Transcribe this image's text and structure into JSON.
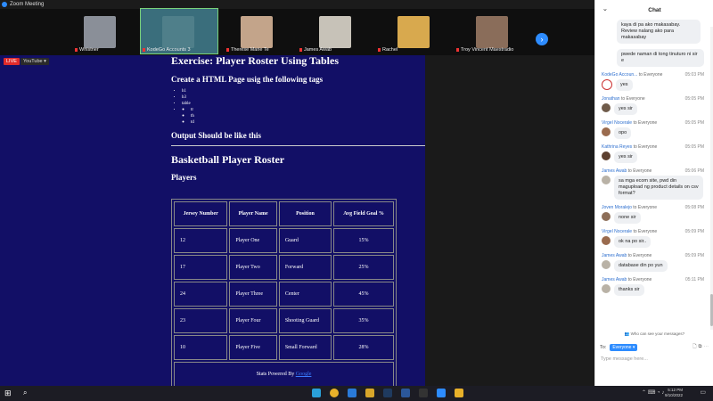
{
  "window": {
    "title": "Zoom Meeting"
  },
  "participants": [
    {
      "name": "Whistner",
      "color": "#8a8f98"
    },
    {
      "name": "KodeGo Accounts 3",
      "color": "#4f7f8a",
      "active": true
    },
    {
      "name": "Therese Marie Te",
      "color": "#c3a48a"
    },
    {
      "name": "James Awab",
      "color": "#c7c2b8"
    },
    {
      "name": "Rachel",
      "color": "#d8a94e"
    },
    {
      "name": "Troy Vincent Maestradio",
      "color": "#8a6d5a"
    }
  ],
  "share": {
    "live_badge": "LIVE",
    "youtube_badge": "YouTube",
    "heading": "Exercise: Player Roster Using Tables",
    "subheading": "Create a HTML Page usig the following tags",
    "tags": [
      "h1",
      "h3",
      "table"
    ],
    "subtags": [
      "tr",
      "th",
      "td"
    ],
    "output_heading": "Output Should be like this",
    "roster_title": "Basketball Player Roster",
    "players_heading": "Players",
    "columns": [
      "Jersey Number",
      "Player Name",
      "Position",
      "Avg Field Goal %"
    ],
    "rows": [
      [
        "12",
        "Player One",
        "Guard",
        "15%"
      ],
      [
        "17",
        "Player Two",
        "Forward",
        "25%"
      ],
      [
        "24",
        "Player Three",
        "Center",
        "45%"
      ],
      [
        "23",
        "Player Four",
        "Shooting Guard",
        "35%"
      ],
      [
        "10",
        "Player Five",
        "Small Forward",
        "28%"
      ]
    ],
    "footer_text": "Stats Powered By",
    "footer_link": "Google"
  },
  "chat": {
    "title": "Chat",
    "messages": [
      {
        "sender": "",
        "to": "",
        "time": "",
        "text": "kaya di pa ako makasabay. Review nalang ako para makasabay"
      },
      {
        "sender": "",
        "to": "",
        "time": "",
        "text": "pwede naman di tong tinuturo ni sir e"
      },
      {
        "sender": "KodeGo Accoun...",
        "to": "to Everyone",
        "time": "05:03 PM",
        "text": "yes"
      },
      {
        "sender": "Jonathan",
        "to": "to Everyone",
        "time": "05:05 PM",
        "text": "yes sir"
      },
      {
        "sender": "Virgel Nocerale",
        "to": "to Everyone",
        "time": "05:05 PM",
        "text": "opo"
      },
      {
        "sender": "Kathrina Reyes",
        "to": "to Everyone",
        "time": "05:05 PM",
        "text": "yes sir"
      },
      {
        "sender": "James Awab",
        "to": "to Everyone",
        "time": "05:06 PM",
        "text": "sa mga ecom site, pwd din magupload ng product details on csv format?"
      },
      {
        "sender": "Joven Moralejo",
        "to": "to Everyone",
        "time": "05:08 PM",
        "text": "none sir"
      },
      {
        "sender": "Virgel Nocerale",
        "to": "to Everyone",
        "time": "05:09 PM",
        "text": "ok na po sir.."
      },
      {
        "sender": "James Awab",
        "to": "to Everyone",
        "time": "05:09 PM",
        "text": "database din po yun"
      },
      {
        "sender": "James Awab",
        "to": "to Everyone",
        "time": "05:11 PM",
        "text": "thanks sir"
      }
    ],
    "visibility_note": "Who can see your messages?",
    "to_label": "To:",
    "recipient": "Everyone",
    "input_placeholder": "Type message here..."
  },
  "taskbar": {
    "time": "5:12 PM",
    "date": "9/10/2022"
  }
}
